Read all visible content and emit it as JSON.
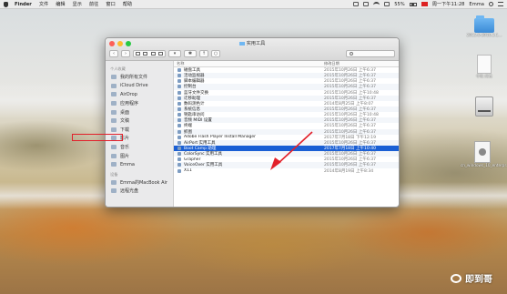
{
  "menubar": {
    "items": [
      "Finder",
      "文件",
      "编辑",
      "显示",
      "前往",
      "窗口",
      "帮助"
    ],
    "battery": "55%",
    "clock": "周一下午11:28",
    "user": "Emma"
  },
  "desktop": {
    "items": [
      {
        "label": "2015.6-2016.3.1..."
      },
      {
        "label": "中帐 所在"
      },
      {
        "label": ""
      },
      {
        "label": "cn_windows_10_enterpr...x64.iso"
      }
    ]
  },
  "watermark": "即到哥",
  "finder": {
    "title": "实用工具",
    "sidebar": [
      {
        "section": "个人收藏",
        "items": [
          "我的所有文件",
          "iCloud Drive",
          "AirDrop",
          "应用程序",
          "桌面",
          "文稿",
          "下载",
          "影片",
          "音乐",
          "图片",
          "Emma"
        ]
      },
      {
        "section": "设备",
        "items": [
          "Emma的MacBook Air",
          "远程光盘"
        ]
      }
    ],
    "columns": {
      "name": "名称",
      "date": "修改日期"
    },
    "files": [
      {
        "name": "磁盘工具",
        "date": "2015年10月26日 上午6:37"
      },
      {
        "name": "活动监视器",
        "date": "2015年10月26日 上午6:37"
      },
      {
        "name": "脚本编辑器",
        "date": "2015年10月26日 上午6:37"
      },
      {
        "name": "控制台",
        "date": "2015年10月26日 上午6:37"
      },
      {
        "name": "蓝牙文件交换",
        "date": "2015年10月26日 上午10:48"
      },
      {
        "name": "迁移助理",
        "date": "2015年10月26日 上午6:37"
      },
      {
        "name": "数码测色计",
        "date": "2014年8月25日 上午8:07"
      },
      {
        "name": "系统信息",
        "date": "2015年10月26日 上午6:37"
      },
      {
        "name": "钥匙串访问",
        "date": "2015年10月26日 上午10:48"
      },
      {
        "name": "音频 MIDI 设置",
        "date": "2015年10月26日 上午6:37"
      },
      {
        "name": "终端",
        "date": "2015年10月26日 上午6:37"
      },
      {
        "name": "抓图",
        "date": "2015年10月26日 上午6:37"
      },
      {
        "name": "Adobe Flash Player Install Manager",
        "date": "2017年7月18日 下午12:19"
      },
      {
        "name": "AirPort 实用工具",
        "date": "2015年10月26日 上午6:37"
      },
      {
        "name": "Boot Camp 助理",
        "date": "2017年7月18日 上午10:40"
      },
      {
        "name": "ColorSync 实用工具",
        "date": "2015年10月26日 上午6:37"
      },
      {
        "name": "Grapher",
        "date": "2015年10月26日 上午6:37"
      },
      {
        "name": "VoiceOver 实用工具",
        "date": "2015年10月26日 上午6:37"
      },
      {
        "name": "X11",
        "date": "2014年8月19日 上午8:34"
      }
    ],
    "selected_index": 14
  }
}
